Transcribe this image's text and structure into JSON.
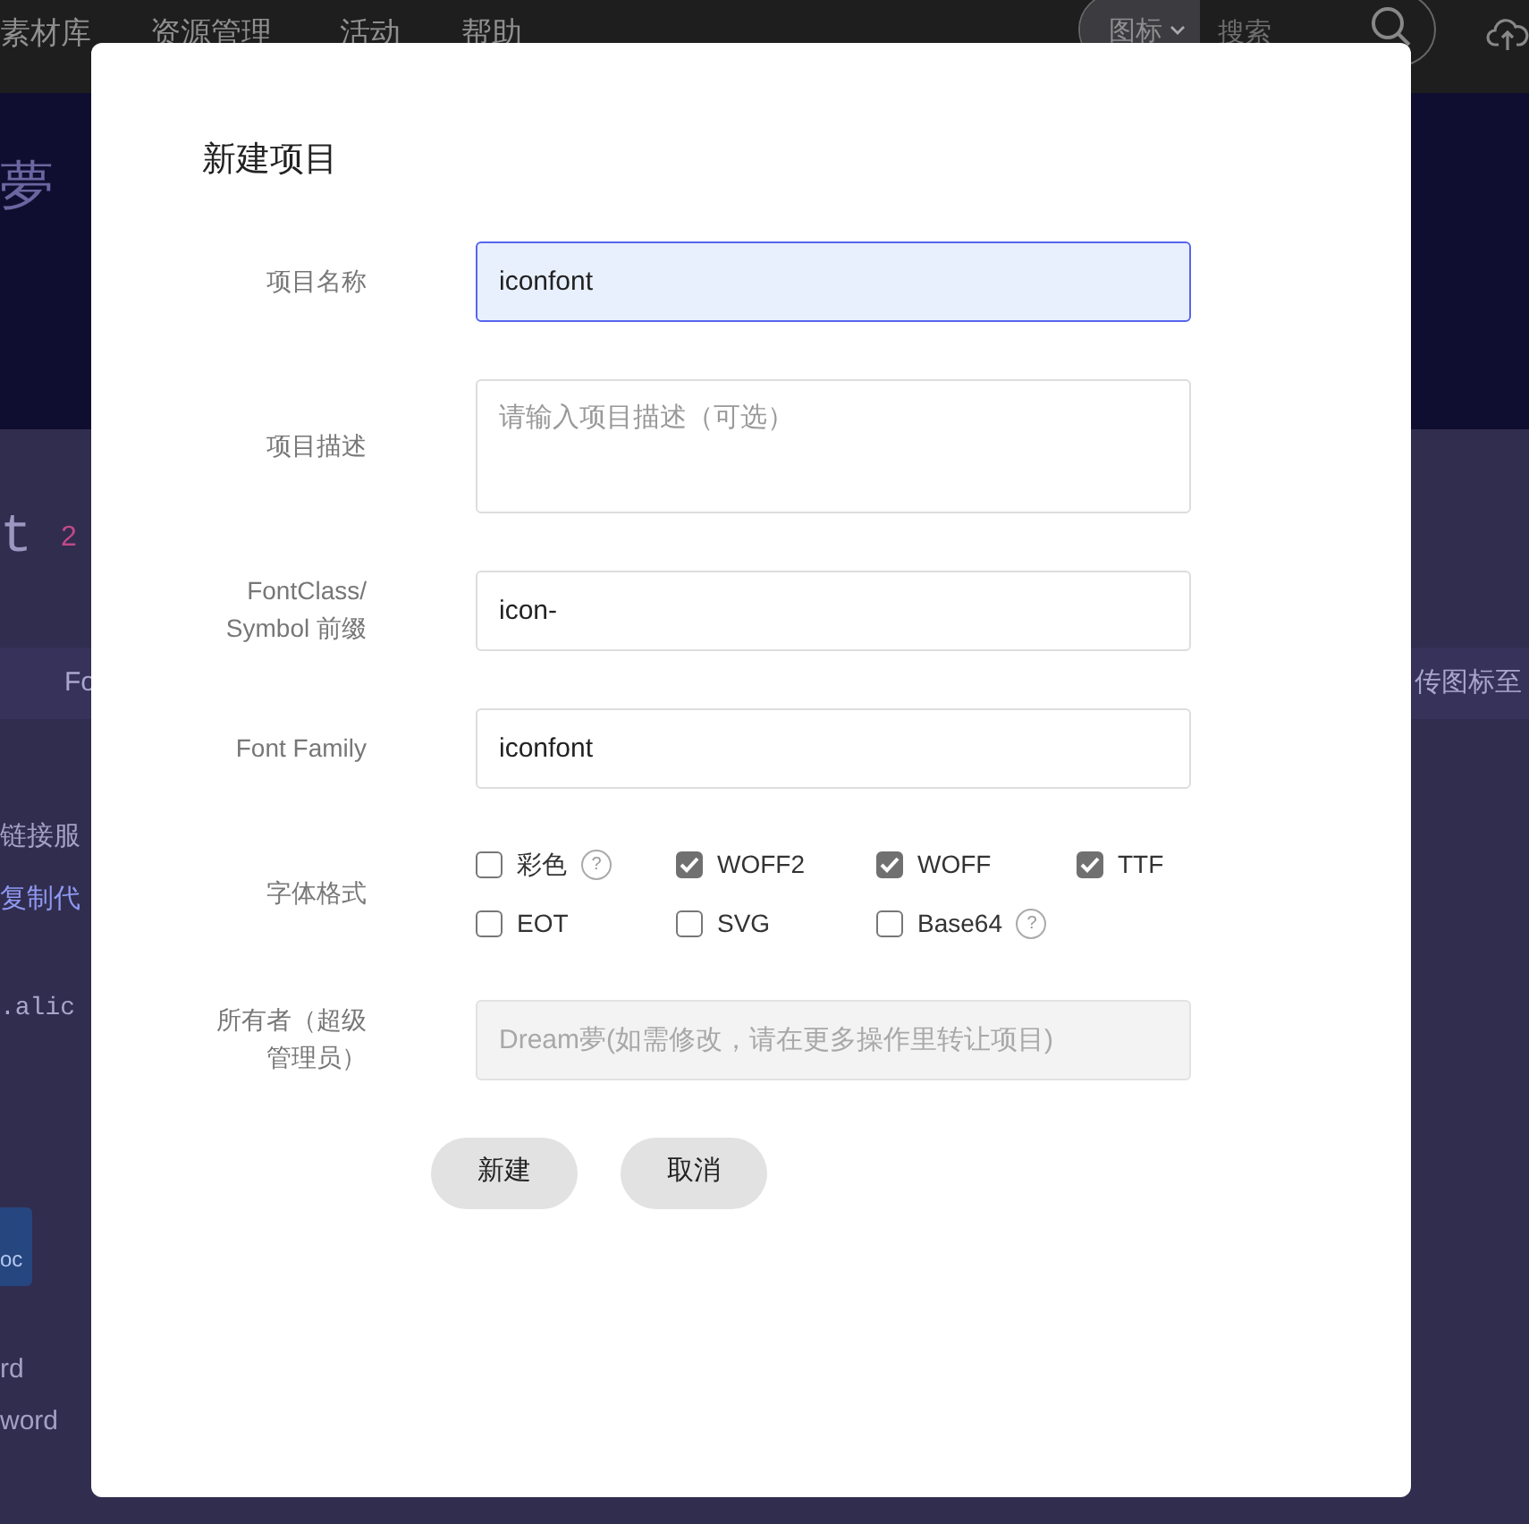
{
  "header": {
    "nav": [
      "素材库",
      "资源管理",
      "活动",
      "帮助"
    ],
    "search": {
      "category": "图标",
      "placeholder": "搜索"
    }
  },
  "banner": {
    "logo_text": "夢"
  },
  "project_heading": {
    "title": "t",
    "count": "2"
  },
  "tab_bar": {
    "left": "Fo",
    "right": "传图标至"
  },
  "background_lines": [
    {
      "kind": "text",
      "text": "链接服"
    },
    {
      "kind": "link",
      "text": "复制代"
    },
    {
      "kind": "code",
      "text": ".alic"
    },
    {
      "kind": "file",
      "text": "oc"
    },
    {
      "kind": "text",
      "text": "rd"
    },
    {
      "kind": "text",
      "text": "word"
    }
  ],
  "dialog": {
    "title": "新建项目",
    "fields": [
      {
        "label": "项目名称",
        "kind": "text",
        "value": "iconfont",
        "focused": true,
        "disabled": false
      },
      {
        "label": "项目描述",
        "kind": "textarea",
        "placeholder": "请输入项目描述（可选）",
        "focused": false,
        "disabled": false
      },
      {
        "label": "FontClass/ Symbol 前缀",
        "kind": "text",
        "value": "icon-",
        "focused": false,
        "disabled": false
      },
      {
        "label": "Font Family",
        "kind": "text",
        "value": "iconfont",
        "focused": false,
        "disabled": false
      },
      {
        "label": "字体格式",
        "kind": "formats",
        "options": [
          {
            "label": "彩色",
            "checked": false,
            "hint": "?"
          },
          {
            "label": "WOFF2",
            "checked": true
          },
          {
            "label": "WOFF",
            "checked": true
          },
          {
            "label": "TTF",
            "checked": true
          },
          {
            "label": "EOT",
            "checked": false
          },
          {
            "label": "SVG",
            "checked": false
          },
          {
            "label": "Base64",
            "checked": false,
            "hint": "?"
          }
        ]
      },
      {
        "label": "所有者（超级管理员）",
        "kind": "text",
        "placeholder": "Dream夢(如需修改，请在更多操作里转让项目)",
        "focused": false,
        "disabled": true
      }
    ],
    "buttons": [
      "新建",
      "取消"
    ]
  }
}
